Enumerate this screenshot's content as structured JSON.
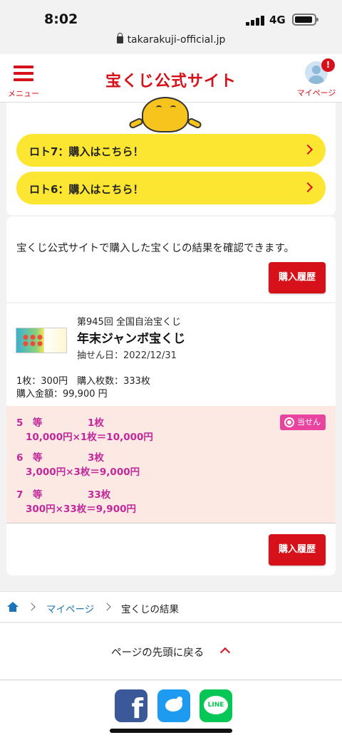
{
  "status_bar": {
    "time": "8:02",
    "network": "4G"
  },
  "url_bar": {
    "url": "takarakuji-official.jp"
  },
  "header": {
    "menu_label": "メニュー",
    "logo": "宝くじ公式サイト",
    "mypage_label": "マイページ",
    "notification_badge": "!"
  },
  "lotto_buttons": [
    {
      "label": "ロト7：購入はこちら！"
    },
    {
      "label": "ロト6：購入はこちら！"
    }
  ],
  "info": {
    "description": "宝くじ公式サイトで購入した宝くじの結果を確認できます。",
    "history_button": "購入履歴"
  },
  "lottery": {
    "round": "第945回 全国自治宝くじ",
    "name": "年末ジャンボ宝くじ",
    "draw_date": "抽せん日：2022/12/31",
    "purchase_line1": "1枚：300円　購入枚数：333枚",
    "purchase_line2": "購入金額：99,900 円",
    "win_badge": "当せん",
    "results": [
      {
        "grade": "5　等",
        "count": "1枚",
        "calc": "10,000円×1枚＝10,000円"
      },
      {
        "grade": "6　等",
        "count": "3枚",
        "calc": "3,000円×3枚＝9,000円"
      },
      {
        "grade": "7　等",
        "count": "33枚",
        "calc": "300円×33枚＝9,900円"
      }
    ],
    "history_button": "購入履歴"
  },
  "breadcrumb": {
    "link": "マイページ",
    "current": "宝くじの結果"
  },
  "back_to_top": "ページの先頭に戻る",
  "social": {
    "facebook_glyph": "f",
    "line_label": "LINE"
  },
  "colors": {
    "brand_red": "#d7111a",
    "pill_yellow": "#fce632",
    "win_pink": "#c1289a",
    "result_bg": "#fde9e4"
  }
}
